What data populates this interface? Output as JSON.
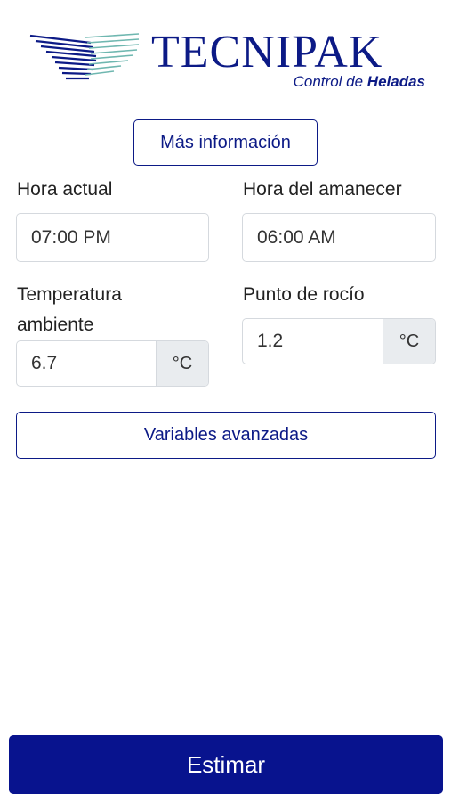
{
  "brand": {
    "name": "TECNIPAK",
    "tagline_prefix": "Control de",
    "tagline_bold": "Heladas"
  },
  "info_button": "Más información",
  "fields": {
    "hora_actual": {
      "label": "Hora actual",
      "value": "07:00 PM"
    },
    "hora_amanecer": {
      "label": "Hora del amanecer",
      "value": "06:00 AM"
    },
    "temperatura": {
      "label_line1": "Temperatura",
      "label_line2": "ambiente",
      "value": "6.7",
      "unit": "°C"
    },
    "punto_rocio": {
      "label": "Punto de rocío",
      "value": "1.2",
      "unit": "°C"
    }
  },
  "advanced_button": "Variables avanzadas",
  "submit_button": "Estimar",
  "colors": {
    "brand": "#0c1a86",
    "primary": "#08138e",
    "logo_teal": "#6fb7b0"
  },
  "icons": {
    "logo": "tecnipak-stripes-logo"
  }
}
